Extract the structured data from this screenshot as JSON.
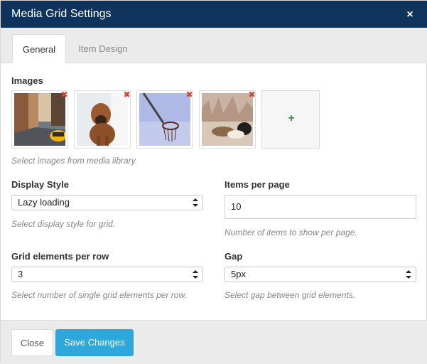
{
  "window": {
    "title": "Media Grid Settings",
    "close_glyph": "×"
  },
  "tabs": [
    {
      "label": "General",
      "active": true
    },
    {
      "label": "Item Design",
      "active": false
    }
  ],
  "images": {
    "label": "Images",
    "help": "Select images from media library.",
    "thumbnails": [
      {
        "subject": "city street with taxi",
        "remove_glyph": "✖"
      },
      {
        "subject": "boxer dog",
        "remove_glyph": "✖"
      },
      {
        "subject": "basketball hoop",
        "remove_glyph": "✖"
      },
      {
        "subject": "ducks",
        "remove_glyph": "✖"
      }
    ],
    "add_glyph": "+"
  },
  "display_style": {
    "label": "Display Style",
    "value": "Lazy loading",
    "help": "Select display style for grid."
  },
  "items_per_page": {
    "label": "Items per page",
    "value": "10",
    "help": "Number of items to show per page."
  },
  "grid_elements_per_row": {
    "label": "Grid elements per row",
    "value": "3",
    "help": "Select number of single grid elements per row."
  },
  "gap": {
    "label": "Gap",
    "value": "5px",
    "help": "Select gap between grid elements."
  },
  "footer": {
    "close_label": "Close",
    "save_label": "Save Changes"
  },
  "colors": {
    "title_bar": "#0e345d",
    "primary_button": "#2ea7dc",
    "remove_icon": "#e2402c",
    "add_icon": "#2aa22a"
  }
}
